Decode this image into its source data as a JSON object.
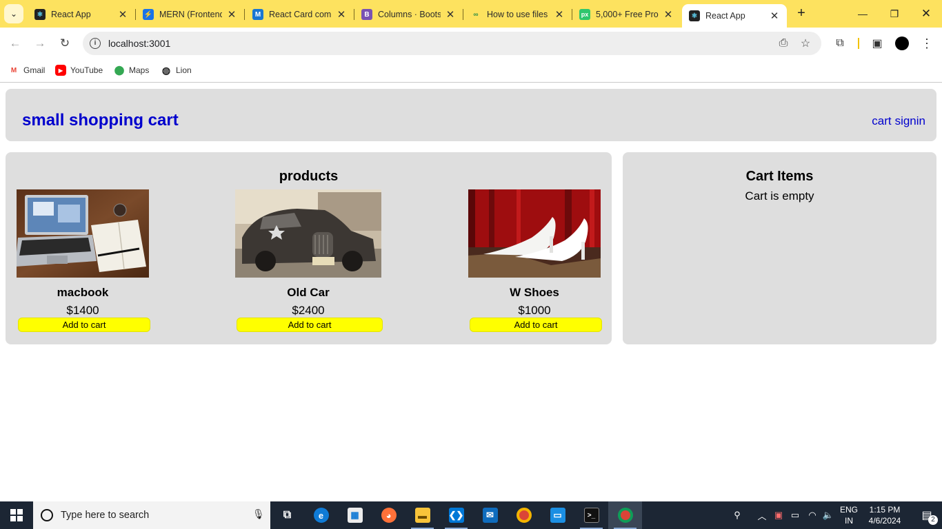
{
  "browser": {
    "tabs": [
      {
        "title": "React App",
        "favicon": "react-icon",
        "color": "#1d1d1d"
      },
      {
        "title": "MERN (Frontend",
        "favicon": "lightning-icon",
        "color": "#1a73e8"
      },
      {
        "title": "React Card comp",
        "favicon": "mui-icon",
        "color": "#1976d2"
      },
      {
        "title": "Columns · Boots",
        "favicon": "bootstrap-icon",
        "color": "#7952b3"
      },
      {
        "title": "How to use files",
        "favicon": "geeks-icon",
        "color": "#2f8d46"
      },
      {
        "title": "5,000+ Free Pro",
        "favicon": "pixabay-icon",
        "color": "#2ec66d"
      },
      {
        "title": "React App",
        "favicon": "react-icon",
        "color": "#1d1d1d"
      }
    ],
    "address": "localhost:3001",
    "bookmarks": [
      {
        "label": "Gmail",
        "icon": "gmail-icon"
      },
      {
        "label": "YouTube",
        "icon": "youtube-icon"
      },
      {
        "label": "Maps",
        "icon": "maps-icon"
      },
      {
        "label": "Lion",
        "icon": "globe-icon"
      }
    ],
    "tab_strip_color": "#fde25f"
  },
  "app": {
    "brand": "small shopping cart",
    "nav": {
      "cart": "cart",
      "signin": "signin"
    },
    "products_title": "products",
    "products": [
      {
        "name": "macbook",
        "price": "$1400",
        "button": "Add to cart",
        "image": "laptop-photo"
      },
      {
        "name": "Old Car",
        "price": "$2400",
        "button": "Add to cart",
        "image": "vintage-car-photo"
      },
      {
        "name": "W Shoes",
        "price": "$1000",
        "button": "Add to cart",
        "image": "white-heels-photo"
      }
    ],
    "cart": {
      "title": "Cart Items",
      "empty_text": "Cart is empty"
    },
    "colors": {
      "brand": "#0000cd",
      "panel": "#dedede",
      "button": "#ffff00"
    }
  },
  "taskbar": {
    "search_placeholder": "Type here to search",
    "lang_top": "ENG",
    "lang_bottom": "IN",
    "time": "1:15 PM",
    "date": "4/6/2024",
    "notifications": "2"
  }
}
